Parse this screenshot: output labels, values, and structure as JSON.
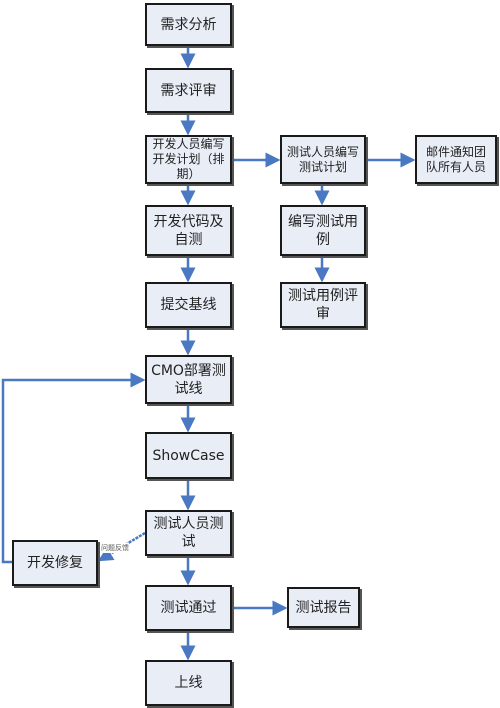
{
  "nodes": {
    "req_analysis": "需求分析",
    "req_review": "需求评审",
    "dev_plan": "开发人员编写开发计划（排期）",
    "dev_code": "开发代码及自测",
    "submit_baseline": "提交基线",
    "cmo_deploy": "CMO部署测试线",
    "showcase": "ShowCase",
    "tester_test": "测试人员测试",
    "test_pass": "测试通过",
    "release": "上线",
    "test_plan": "测试人员编写测试计划",
    "email_notify": "邮件通知团队所有人员",
    "write_cases": "编写测试用例",
    "case_review": "测试用例评审",
    "test_report": "测试报告",
    "dev_fix": "开发修复"
  },
  "edge_labels": {
    "feedback": "问题反馈"
  },
  "colors": {
    "arrow": "#4a78c2",
    "box_fill": "#e8edf6",
    "border": "#1a1a1a"
  }
}
